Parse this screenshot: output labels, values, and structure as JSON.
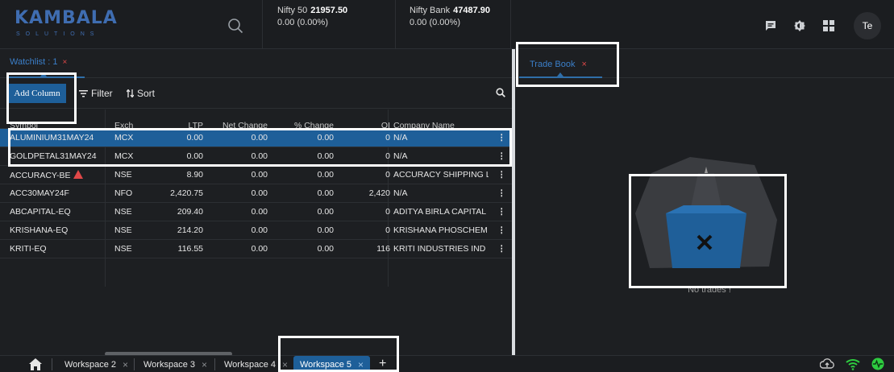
{
  "brand": {
    "name": "KAMBALA",
    "tagline": "SOLUTIONS"
  },
  "indices": [
    {
      "name": "Nifty 50",
      "value": "21957.50",
      "change": "0.00 (0.00%)"
    },
    {
      "name": "Nifty Bank",
      "value": "47487.90",
      "change": "0.00 (0.00%)"
    }
  ],
  "header": {
    "icons": [
      "chat-icon",
      "theme-icon",
      "apps-grid-icon"
    ],
    "avatar": "Te"
  },
  "watchlist": {
    "tab_label": "Watchlist : 1",
    "tab_close": "×",
    "toolbar": {
      "add_column": "Add Column",
      "filter": "Filter",
      "sort": "Sort"
    },
    "columns": [
      "Symbol",
      "Exch",
      "LTP",
      "Net Change",
      "% Change",
      "OI",
      "Company Name"
    ],
    "rows": [
      {
        "symbol": "ALUMINIUM31MAY24",
        "exch": "MCX",
        "ltp": "0.00",
        "net": "0.00",
        "pct": "0.00",
        "oi": "0",
        "company": "N/A",
        "selected": true
      },
      {
        "symbol": "GOLDPETAL31MAY24",
        "exch": "MCX",
        "ltp": "0.00",
        "net": "0.00",
        "pct": "0.00",
        "oi": "0",
        "company": "N/A"
      },
      {
        "symbol": "ACCURACY-BE",
        "exch": "NSE",
        "ltp": "8.90",
        "net": "0.00",
        "pct": "0.00",
        "oi": "0",
        "company": "ACCURACY SHIPPING LIN",
        "warning": true
      },
      {
        "symbol": "ACC30MAY24F",
        "exch": "NFO",
        "ltp": "2,420.75",
        "net": "0.00",
        "pct": "0.00",
        "oi": "2,420",
        "company": "N/A"
      },
      {
        "symbol": "ABCAPITAL-EQ",
        "exch": "NSE",
        "ltp": "209.40",
        "net": "0.00",
        "pct": "0.00",
        "oi": "0",
        "company": "ADITYA BIRLA CAPITAL L"
      },
      {
        "symbol": "KRISHANA-EQ",
        "exch": "NSE",
        "ltp": "214.20",
        "net": "0.00",
        "pct": "0.00",
        "oi": "0",
        "company": "KRISHANA PHOSCHEM L"
      },
      {
        "symbol": "KRITI-EQ",
        "exch": "NSE",
        "ltp": "116.55",
        "net": "0.00",
        "pct": "0.00",
        "oi": "116",
        "company": "KRITI INDUSTRIES IND LT"
      }
    ],
    "row_menu": "⋮"
  },
  "tradebook": {
    "tab_label": "Trade Book",
    "tab_close": "×",
    "empty_text": "No trades !"
  },
  "workspaces": [
    {
      "label": "Workspace 2",
      "close": "×"
    },
    {
      "label": "Workspace 3",
      "close": "×"
    },
    {
      "label": "Workspace 4",
      "close": "×"
    },
    {
      "label": "Workspace 5",
      "close": "×",
      "active": true
    }
  ],
  "add_workspace": "+",
  "colors": {
    "accent": "#1e5f99",
    "background": "#1d1f22",
    "close": "#e04848",
    "status_green": "#2ecc40"
  }
}
